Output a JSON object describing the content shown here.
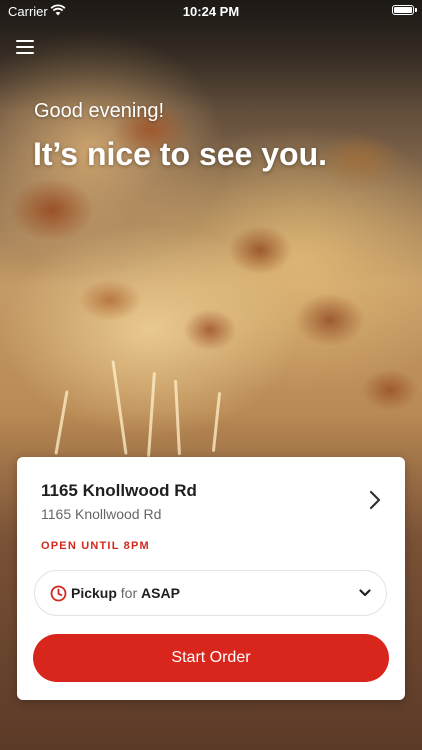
{
  "status_bar": {
    "carrier": "Carrier",
    "time": "10:24 PM",
    "wifi_icon": "wifi-icon",
    "battery_icon": "battery-icon"
  },
  "header": {
    "menu_icon": "hamburger-menu-icon",
    "greeting": "Good evening!",
    "headline": "It’s nice to see you."
  },
  "location": {
    "name": "1165 Knollwood Rd",
    "address": "1165 Knollwood Rd",
    "hours": "OPEN UNTIL 8PM",
    "chevron_icon": "chevron-right-icon"
  },
  "order_type": {
    "icon": "clock-icon",
    "mode": "Pickup",
    "connector": "for",
    "when": "ASAP",
    "dropdown_icon": "chevron-down-icon"
  },
  "actions": {
    "start_order": "Start Order"
  },
  "colors": {
    "accent": "#d9261c",
    "hours_text": "#d3281d"
  }
}
